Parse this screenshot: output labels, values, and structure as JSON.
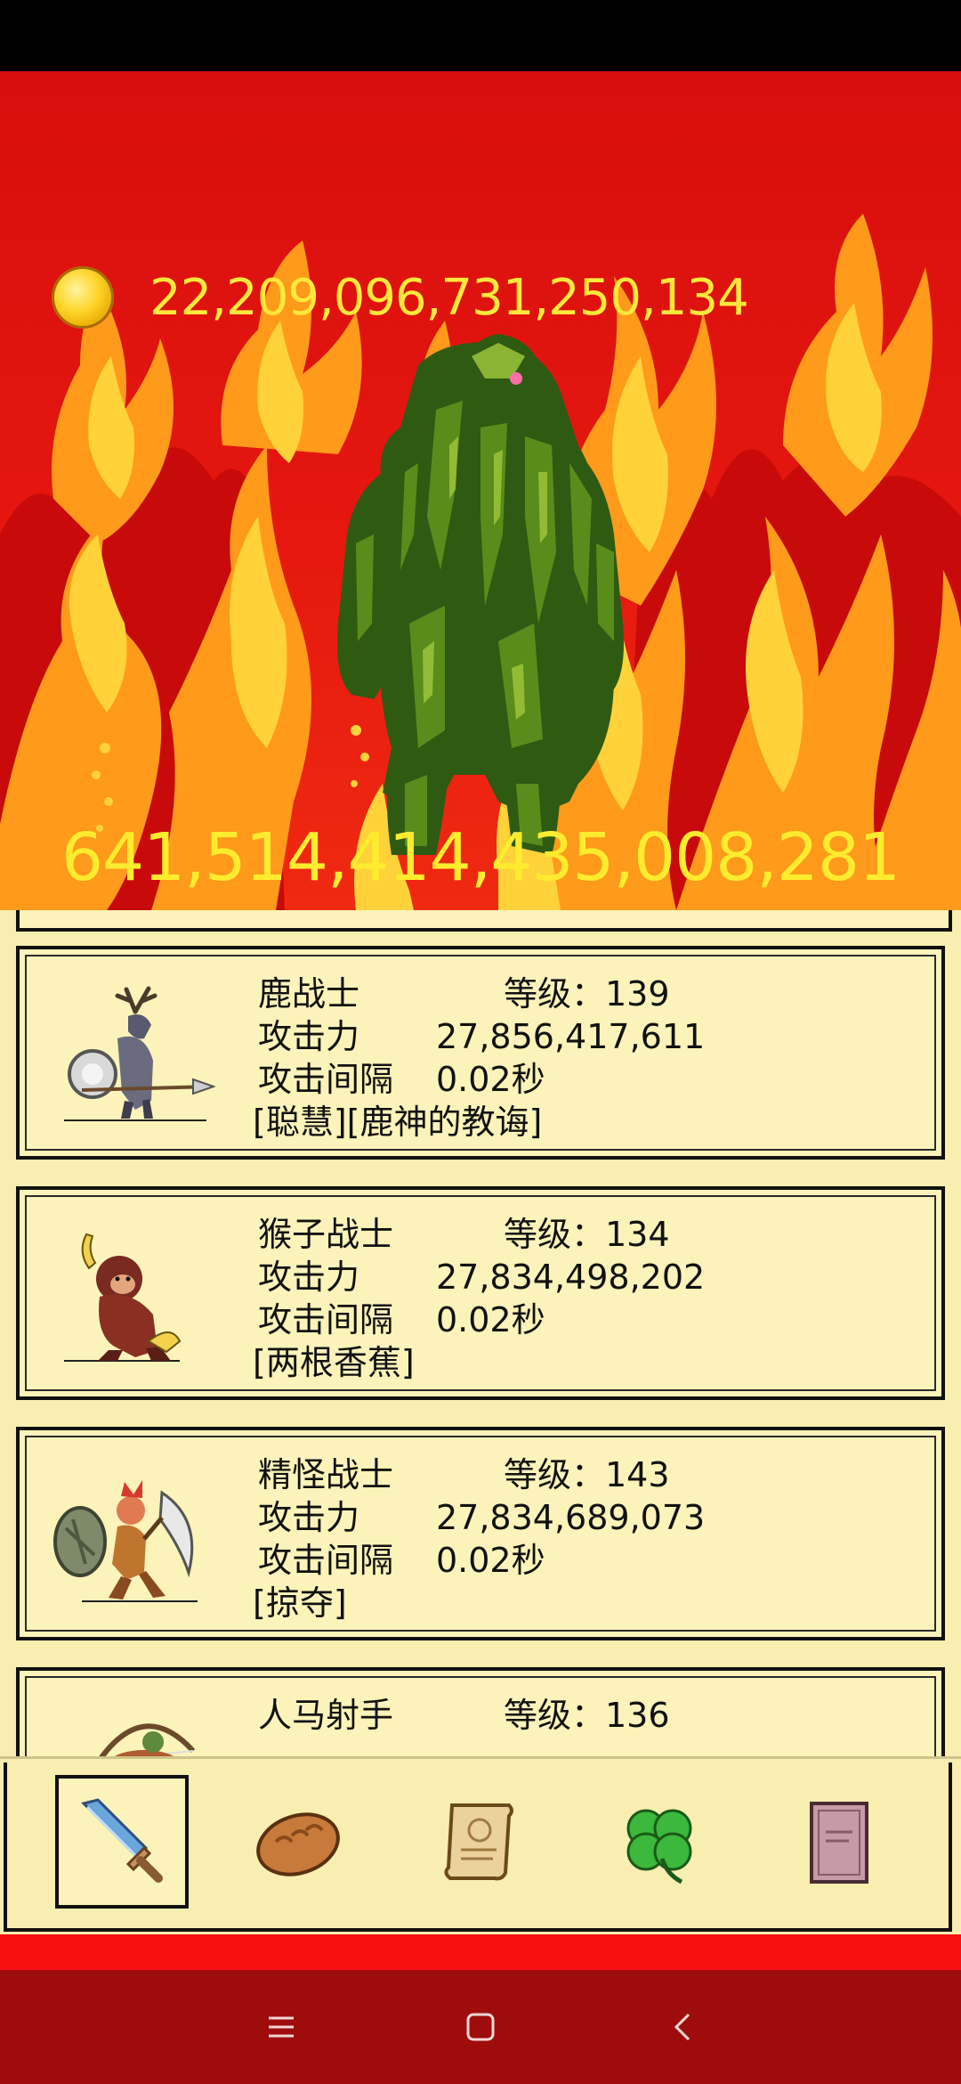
{
  "hud": {
    "gold_amount": "22,209,096,731,250,134",
    "enemy_hp": "641,514,414,435,008,281"
  },
  "icons": {
    "currency": "gold-coin-icon",
    "menu": [
      "sword-icon",
      "bread-icon",
      "scroll-icon",
      "clover-icon",
      "book-icon"
    ],
    "nav": [
      "menu-lines-icon",
      "home-square-icon",
      "back-chevron-icon"
    ]
  },
  "colors": {
    "background_red": "#e5170f",
    "flame_orange": "#ff9a1a",
    "flame_yellow": "#ffd23a",
    "text_yellow": "#ffe83a",
    "panel_cream": "#f7eeb0",
    "nav_dark_red": "#9e0c0c"
  },
  "heroes": [
    {
      "name": "鹿战士",
      "level_label": "等级：139",
      "attack_label": "攻击力",
      "attack_value": "27,856,417,611",
      "interval_label": "攻击间隔",
      "interval_value": "0.02秒",
      "traits": "[聪慧][鹿神的教诲]"
    },
    {
      "name": "猴子战士",
      "level_label": "等级：134",
      "attack_label": "攻击力",
      "attack_value": "27,834,498,202",
      "interval_label": "攻击间隔",
      "interval_value": "0.02秒",
      "traits": "[两根香蕉]"
    },
    {
      "name": "精怪战士",
      "level_label": "等级：143",
      "attack_label": "攻击力",
      "attack_value": "27,834,689,073",
      "interval_label": "攻击间隔",
      "interval_value": "0.02秒",
      "traits": "[掠夺]"
    },
    {
      "name": "人马射手",
      "level_label": "等级：136"
    }
  ]
}
